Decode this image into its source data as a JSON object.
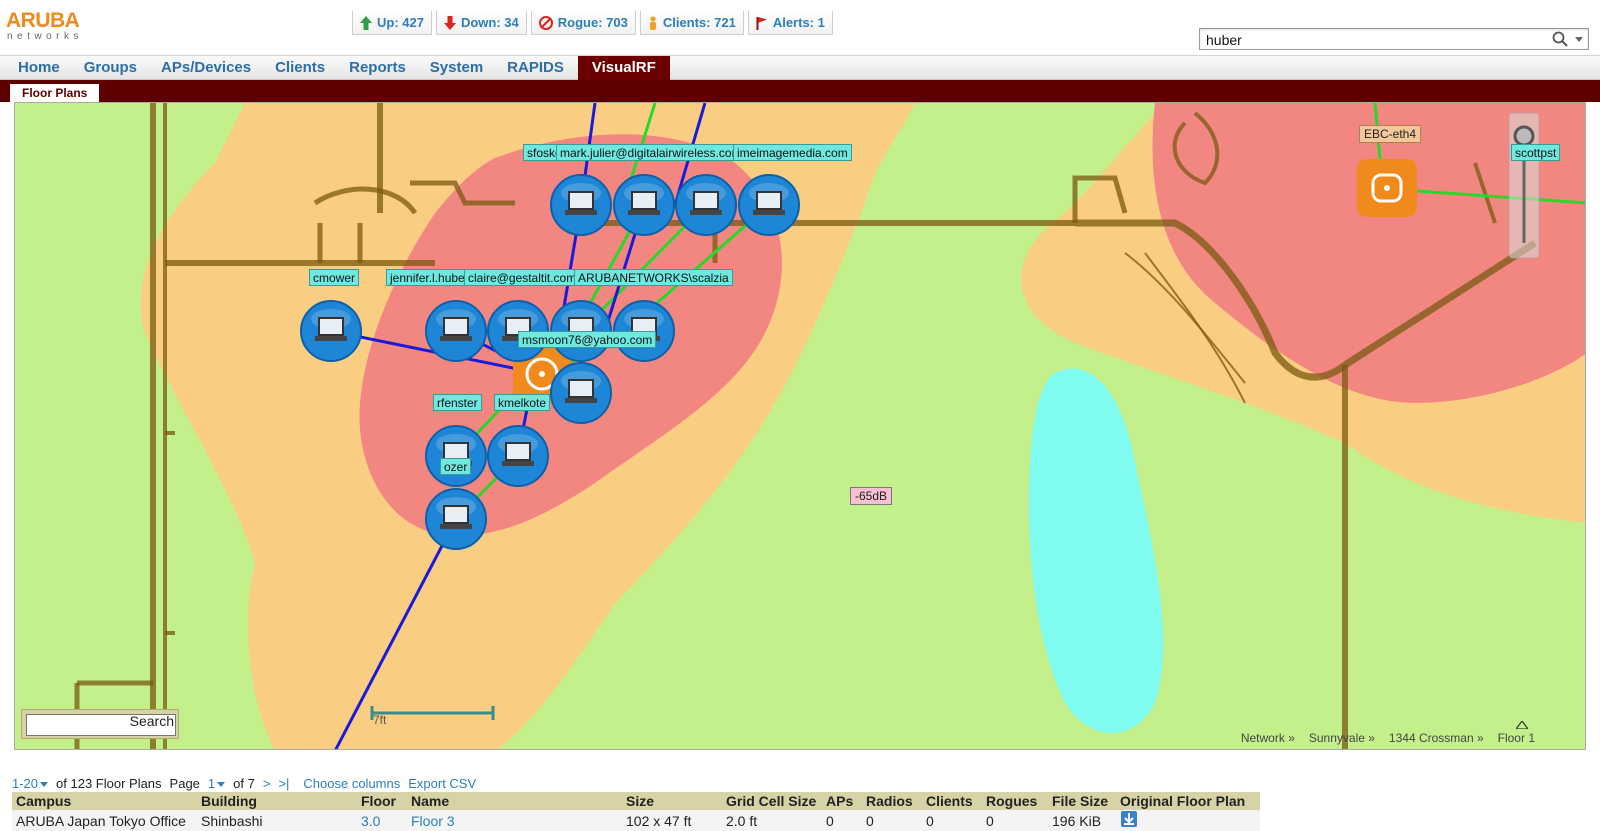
{
  "brand": {
    "name": "ARUBA",
    "tagline": "networks"
  },
  "status": [
    {
      "label": "Up: 427",
      "icon": "up-arrow-icon"
    },
    {
      "label": "Down: 34",
      "icon": "down-arrow-icon"
    },
    {
      "label": "Rogue: 703",
      "icon": "rogue-icon"
    },
    {
      "label": "Clients: 721",
      "icon": "client-icon"
    },
    {
      "label": "Alerts: 1",
      "icon": "alert-flag-icon"
    }
  ],
  "search": {
    "value": "huber"
  },
  "nav": {
    "items": [
      "Home",
      "Groups",
      "APs/Devices",
      "Clients",
      "Reports",
      "System",
      "RAPIDS",
      "VisualRF"
    ],
    "active": "VisualRF"
  },
  "subnav": {
    "tab": "Floor Plans"
  },
  "map": {
    "client_labels": {
      "sfoske": "sfoske",
      "mark": "mark.julier@digitalairwireless.com",
      "media": "imeimagemedia.com",
      "cmower": "cmower",
      "jennifer": "jennifer.l.huber",
      "claire": "claire@gestaltit.com",
      "scalzia": "ARUBANETWORKS\\scalzia",
      "msmoon": "msmoon76@yahoo.com",
      "rfenster": "rfenster",
      "kmelkote": "kmelkote",
      "ozer": "ozer",
      "scott": "scottpst"
    },
    "ap_label": "EBC-eth4",
    "signal_label": "-65dB",
    "scale_label": "7ft",
    "search_button": "Search",
    "breadcrumb": [
      "Network »",
      "Sunnyvale »",
      "1344 Crossman »",
      "Floor 1"
    ]
  },
  "list": {
    "range": "1-20",
    "total": "of 123 Floor Plans",
    "page_label": "Page",
    "page": "1",
    "of_pages": "of 7",
    "next": ">",
    "last": ">|",
    "choose_columns": "Choose columns",
    "export": "Export CSV",
    "columns": [
      "Campus",
      "Building",
      "Floor",
      "Name",
      "Size",
      "Grid Cell Size",
      "APs",
      "Radios",
      "Clients",
      "Rogues",
      "File Size",
      "Original Floor Plan"
    ],
    "rows": [
      [
        "ARUBA Japan Tokyo Office",
        "Shinbashi",
        "3.0",
        "Floor 3",
        "102 x 47 ft",
        "2.0 ft",
        "0",
        "0",
        "0",
        "0",
        "196 KiB",
        ""
      ]
    ]
  },
  "colors": {
    "brand_orange": "#f08a1c",
    "nav_link": "#2c6fa8",
    "nav_active": "#6b0000",
    "heat_green": "#c4f08c",
    "heat_orange": "#f9ce82",
    "heat_red": "#f28782",
    "heat_cyan": "#80fbf0",
    "client_blue": "#1e86d6"
  }
}
